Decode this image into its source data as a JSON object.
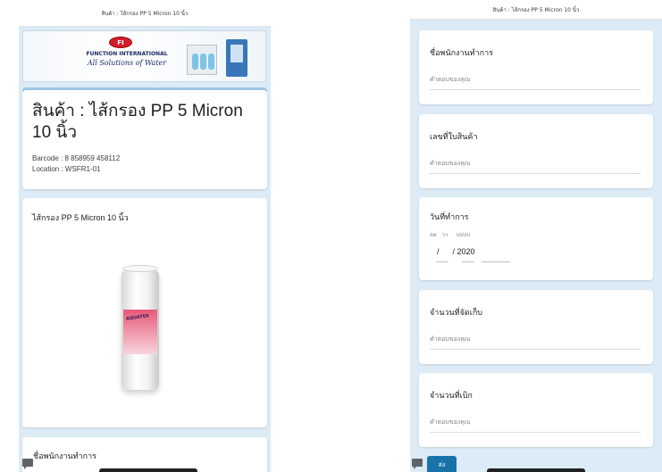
{
  "left": {
    "header_title": "สินค้า : ไส้กรอง PP 5 Micron 10 นิ้ว",
    "banner": {
      "badge": "FI",
      "brand": "FUNCTION INTERNATIONAL",
      "tagline": "All Solutions of Water"
    },
    "product": {
      "title": "สินค้า : ไส้กรอง PP 5 Micron 10 นิ้ว",
      "barcode": "Barcode : 8 858959 458112",
      "location": "Location : WSFR1-01"
    },
    "description": "ไส้กรอง PP 5 Micron 10 นิ้ว",
    "cartridge_label": "AQUATEK",
    "next_question": "ชื่อพนักงานทำการ"
  },
  "right": {
    "header_title": "สินค้า : ไส้กรอง PP 5 Micron 10 นิ้ว",
    "questions": [
      {
        "label": "ชื่อพนักงานทำการ",
        "placeholder": "คำตอบของคุณ"
      },
      {
        "label": "เลขที่ใบสินค้า",
        "placeholder": "คำตอบของคุณ"
      },
      {
        "label": "จำนวนที่จัดเก็บ",
        "placeholder": "คำตอบของคุณ"
      },
      {
        "label": "จำนวนที่เบิก",
        "placeholder": "คำตอบของคุณ"
      }
    ],
    "date_question": {
      "label": "วันที่ทำการ",
      "hints": "ดด   วว     ปปปป",
      "value": "/      / 2020"
    },
    "submit_label": "ส่ง"
  },
  "colors": {
    "background": "#dcebf5",
    "card": "#ffffff",
    "accent": "#9ec6e5",
    "submit": "#1a73a8"
  }
}
